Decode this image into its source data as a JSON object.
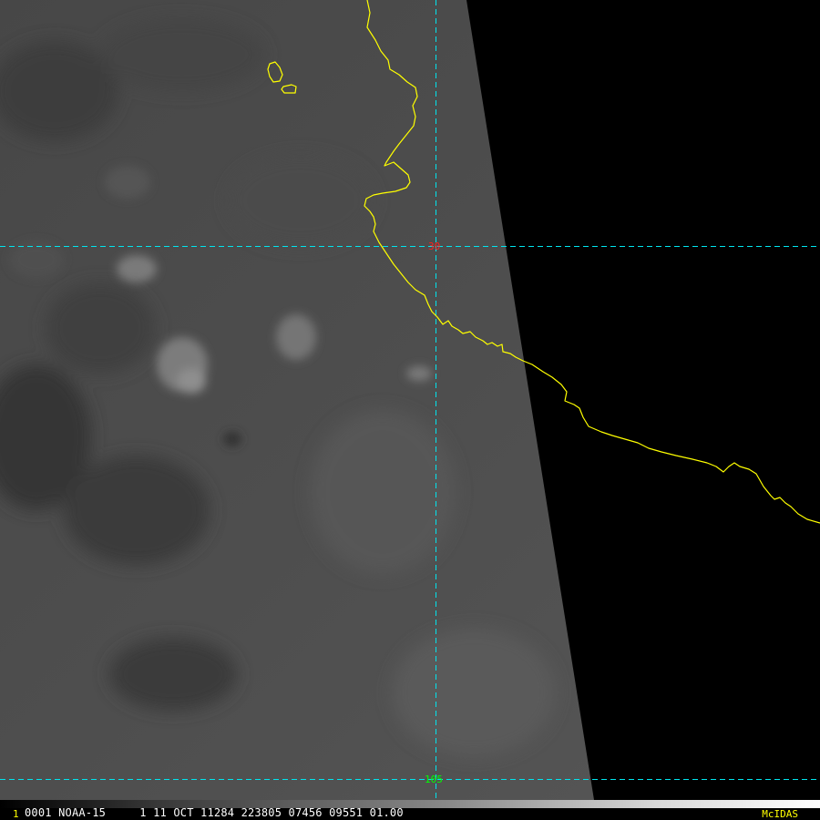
{
  "map": {
    "grid_labels": {
      "latitude_line": "30",
      "longitude_line": "105"
    },
    "colors": {
      "coastline": "#ffff00",
      "grid": "#00e5ee",
      "lat_label": "#ff2020",
      "lon_label": "#00ff00",
      "background": "#000000"
    }
  },
  "status_bar": {
    "frame_number": "1",
    "info_text": "0001 NOAA-15     1 11 OCT 11284 223805 07456 09551 01.00",
    "brand": "McIDAS"
  }
}
